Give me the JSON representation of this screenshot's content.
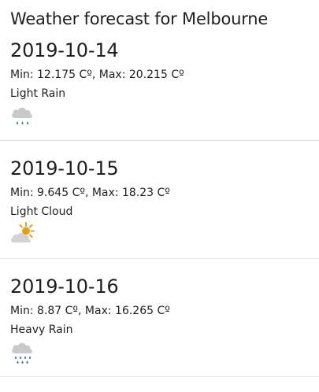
{
  "page": {
    "title": "Weather forecast for Melbourne"
  },
  "forecast": [
    {
      "date": "2019-10-14",
      "min_label": "Min:",
      "min_value": "12.175",
      "max_label": "Max:",
      "max_value": "20.215",
      "unit": "Cº",
      "condition": "Light Rain",
      "icon": "light-rain-icon"
    },
    {
      "date": "2019-10-15",
      "min_label": "Min:",
      "min_value": "9.645",
      "max_label": "Max:",
      "max_value": "18.23",
      "unit": "Cº",
      "condition": "Light Cloud",
      "icon": "light-cloud-icon"
    },
    {
      "date": "2019-10-16",
      "min_label": "Min:",
      "min_value": "8.87",
      "max_label": "Max:",
      "max_value": "16.265",
      "unit": "Cº",
      "condition": "Heavy Rain",
      "icon": "heavy-rain-icon"
    }
  ],
  "colors": {
    "text": "#1f1f1f",
    "cloud": "#c9c9c9",
    "rain": "#2e6f86",
    "sun": "#e0a020",
    "divider": "#e4e4e4"
  }
}
